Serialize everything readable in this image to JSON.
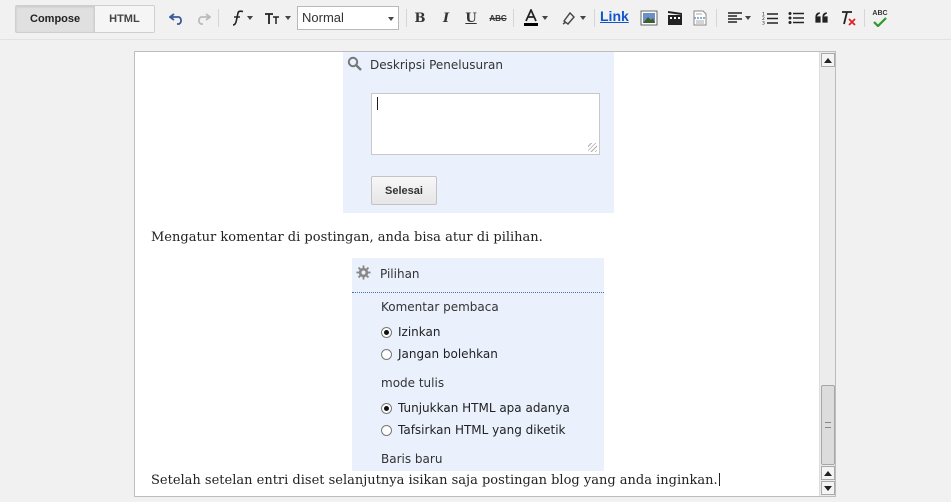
{
  "toolbar": {
    "mode_tabs": {
      "compose": "Compose",
      "html": "HTML"
    },
    "format_select": {
      "value": "Normal"
    },
    "link_label": "Link",
    "spell_label": "ABC",
    "strike_label": "ABC",
    "text_color_accent": "#000000",
    "link_color": "#1155cc"
  },
  "editor": {
    "search_panel": {
      "title": "Deskripsi Penelusuran",
      "textarea_value": "",
      "done_button": "Selesai"
    },
    "paragraph_1": "Mengatur komentar di postingan, anda bisa atur di pilihan.",
    "options_panel": {
      "title": "Pilihan",
      "reader_comments": {
        "label": "Komentar pembaca",
        "options": [
          {
            "label": "Izinkan",
            "selected": true
          },
          {
            "label": "Jangan bolehkan",
            "selected": false
          }
        ]
      },
      "compose_mode": {
        "label": "mode tulis",
        "options": [
          {
            "label": "Tunjukkan HTML apa adanya",
            "selected": true
          },
          {
            "label": "Tafsirkan HTML yang diketik",
            "selected": false
          }
        ]
      },
      "line_breaks": {
        "label": "Baris baru"
      }
    },
    "paragraph_2": "Setelah setelan entri diset selanjutnya isikan saja postingan blog yang anda inginkan."
  }
}
